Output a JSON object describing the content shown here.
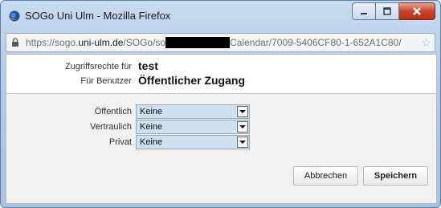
{
  "window": {
    "title": "SOGo Uni Ulm - Mozilla Firefox"
  },
  "urlbar": {
    "scheme": "https://sogo.",
    "domain": "uni-ulm.de",
    "path_start": "/SOGo/so",
    "path_end": "Calendar/7009-5406CF80-1-652A1C80/"
  },
  "header": {
    "rights_for_label": "Zugriffsrechte für",
    "rights_for_value": "test",
    "for_user_label": "Für Benutzer",
    "for_user_value": "Öffentlicher Zugang"
  },
  "form": {
    "rows": [
      {
        "label": "Öffentlich",
        "value": "Keine"
      },
      {
        "label": "Vertraulich",
        "value": "Keine"
      },
      {
        "label": "Privat",
        "value": "Keine"
      }
    ]
  },
  "buttons": {
    "cancel": "Abbrechen",
    "save": "Speichern"
  },
  "colors": {
    "select_bg": "#cde1ef",
    "panel_bg": "#f1f1f1",
    "close_button": "#c7432b"
  },
  "icons": [
    "firefox-icon",
    "minimize-icon",
    "maximize-icon",
    "close-icon",
    "lock-icon",
    "star-icon",
    "dropdown-arrow-icon"
  ]
}
